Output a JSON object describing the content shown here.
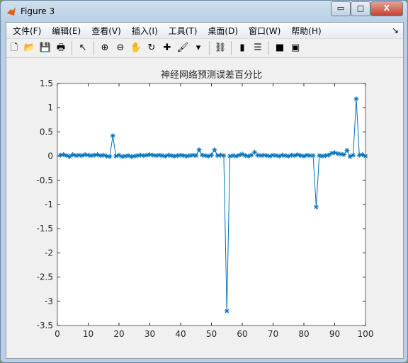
{
  "window": {
    "title": "Figure 3",
    "minimize": "▭",
    "maximize": "□",
    "close": "X"
  },
  "menu": [
    "文件(F)",
    "编辑(E)",
    "查看(V)",
    "插入(I)",
    "工具(T)",
    "桌面(D)",
    "窗口(W)",
    "帮助(H)"
  ],
  "menu_arrow": "↘",
  "toolbar": [
    {
      "icon": "new-figure-icon",
      "g": "🗋"
    },
    {
      "icon": "open-icon",
      "g": "📂"
    },
    {
      "icon": "save-icon",
      "g": "💾"
    },
    {
      "icon": "print-icon",
      "g": "🖶"
    },
    {
      "sep": true
    },
    {
      "icon": "pointer-icon",
      "g": "↖"
    },
    {
      "sep": true
    },
    {
      "icon": "zoom-in-icon",
      "g": "⊕"
    },
    {
      "icon": "zoom-out-icon",
      "g": "⊖"
    },
    {
      "icon": "pan-icon",
      "g": "✋"
    },
    {
      "icon": "rotate-icon",
      "g": "↻"
    },
    {
      "icon": "data-cursor-icon",
      "g": "✚"
    },
    {
      "icon": "brush-icon",
      "g": "🖌"
    },
    {
      "icon": "dropdown-icon",
      "g": "▾"
    },
    {
      "sep": true
    },
    {
      "icon": "link-icon",
      "g": "⛓"
    },
    {
      "sep": true
    },
    {
      "icon": "colorbar-icon",
      "g": "▮"
    },
    {
      "icon": "legend-icon",
      "g": "☰"
    },
    {
      "sep": true
    },
    {
      "icon": "hide-plot-tools-icon",
      "g": "■"
    },
    {
      "icon": "show-plot-tools-icon",
      "g": "▣"
    }
  ],
  "chart_data": {
    "type": "line",
    "title": "神经网络预测误差百分比",
    "marker": "*",
    "color": "#0072bd",
    "xlim": [
      0,
      100
    ],
    "ylim": [
      -3.5,
      1.5
    ],
    "xticks": [
      0,
      10,
      20,
      30,
      40,
      50,
      60,
      70,
      80,
      90,
      100
    ],
    "yticks": [
      1.5,
      1,
      0.5,
      0,
      -0.5,
      -1,
      -1.5,
      -2,
      -2.5,
      -3,
      -3.5
    ],
    "grid": false,
    "x": [
      1,
      2,
      3,
      4,
      5,
      6,
      7,
      8,
      9,
      10,
      11,
      12,
      13,
      14,
      15,
      16,
      17,
      18,
      19,
      20,
      21,
      22,
      23,
      24,
      25,
      26,
      27,
      28,
      29,
      30,
      31,
      32,
      33,
      34,
      35,
      36,
      37,
      38,
      39,
      40,
      41,
      42,
      43,
      44,
      45,
      46,
      47,
      48,
      49,
      50,
      51,
      52,
      53,
      54,
      55,
      56,
      57,
      58,
      59,
      60,
      61,
      62,
      63,
      64,
      65,
      66,
      67,
      68,
      69,
      70,
      71,
      72,
      73,
      74,
      75,
      76,
      77,
      78,
      79,
      80,
      81,
      82,
      83,
      84,
      85,
      86,
      87,
      88,
      89,
      90,
      91,
      92,
      93,
      94,
      95,
      96,
      97,
      98,
      99,
      100
    ],
    "y": [
      0.02,
      0.03,
      0.01,
      -0.01,
      0.03,
      0.01,
      0.02,
      0.01,
      0.03,
      0.02,
      0.01,
      0.02,
      0.03,
      0.01,
      0.02,
      0.0,
      -0.01,
      0.42,
      0.0,
      0.02,
      -0.01,
      0.0,
      0.01,
      -0.01,
      0.0,
      0.01,
      0.02,
      0.01,
      0.02,
      0.03,
      0.02,
      0.01,
      0.02,
      0.01,
      0.0,
      0.02,
      0.01,
      0.0,
      0.01,
      0.02,
      0.01,
      0.0,
      0.01,
      0.02,
      0.01,
      0.13,
      0.02,
      0.01,
      0.0,
      0.02,
      0.13,
      0.01,
      0.02,
      0.01,
      -3.2,
      0.0,
      0.01,
      0.0,
      0.02,
      0.04,
      0.01,
      0.0,
      0.02,
      0.08,
      0.02,
      0.01,
      0.02,
      0.01,
      0.0,
      0.02,
      0.01,
      0.0,
      0.02,
      0.01,
      0.0,
      0.02,
      0.01,
      0.03,
      0.01,
      0.0,
      0.02,
      0.01,
      0.01,
      -1.05,
      0.01,
      0.0,
      0.01,
      0.02,
      0.06,
      0.07,
      0.05,
      0.04,
      0.03,
      0.12,
      -0.01,
      0.02,
      1.18,
      0.02,
      0.03,
      0.0
    ]
  }
}
